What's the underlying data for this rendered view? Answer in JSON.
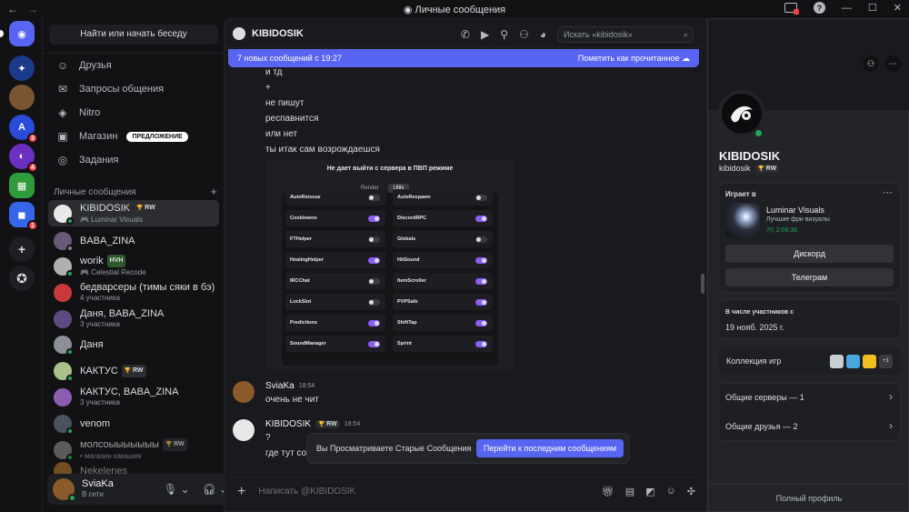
{
  "window": {
    "title": "Личные сообщения",
    "help_glyph": "?"
  },
  "servers": [
    {
      "name": "Discord Home",
      "glyph": "◉",
      "color": "#5865f2"
    },
    {
      "name": "server-2",
      "glyph": "✦",
      "color": "#1c3a8a"
    },
    {
      "name": "server-3",
      "glyph": "",
      "color": "#7a5533"
    },
    {
      "name": "server-4",
      "glyph": "A",
      "color": "#2a4bd8",
      "badge": "3"
    },
    {
      "name": "server-5",
      "glyph": "◐",
      "color": "#6b2fc2",
      "badge": "4"
    },
    {
      "name": "server-6",
      "glyph": "▦",
      "color": "#2f9b3a"
    },
    {
      "name": "server-7",
      "glyph": "◼",
      "color": "#3565e8",
      "badge": "1"
    }
  ],
  "sidebar": {
    "search_label": "Найти или начать беседу",
    "nav": [
      {
        "label": "Друзья",
        "icon": "friends-icon",
        "glyph": "☺"
      },
      {
        "label": "Запросы общения",
        "icon": "envelope-icon",
        "glyph": "✉"
      },
      {
        "label": "Nitro",
        "icon": "nitro-icon",
        "glyph": "◈"
      },
      {
        "label": "Магазин",
        "icon": "shop-icon",
        "glyph": "▣",
        "pill": "ПРЕДЛОЖЕНИЕ"
      },
      {
        "label": "Задания",
        "icon": "quests-icon",
        "glyph": "◎"
      }
    ],
    "dm_header": "Личные сообщения",
    "dms": [
      {
        "name": "KIBIDOSIK",
        "tag": "RW",
        "sub": "🎮 Luminar Visuals",
        "online": true
      },
      {
        "name": "BABA_ZINA",
        "tag": "",
        "sub": "",
        "online": false
      },
      {
        "name": "worik",
        "tag": "HVH",
        "sub": "🎮 Celestial Recode",
        "online": true
      },
      {
        "name": "бедварсеры (тимы сяки в бэ)",
        "tag": "",
        "sub": "4 участника",
        "online": false
      },
      {
        "name": "Даня, BABA_ZINA",
        "tag": "",
        "sub": "3 участника",
        "online": false
      },
      {
        "name": "Даня",
        "tag": "",
        "sub": "",
        "online": true
      },
      {
        "name": "КАКТУС",
        "tag": "RW",
        "sub": "",
        "online": true
      },
      {
        "name": "КАКТУС, BABA_ZINA",
        "tag": "",
        "sub": "3 участника",
        "online": false
      },
      {
        "name": "venom",
        "tag": "",
        "sub": "",
        "online": true
      },
      {
        "name": "молсоыыыыыыы",
        "tag": "RW",
        "sub": "• магазин какашек",
        "online": true
      },
      {
        "name": "Nekelenes",
        "tag": "",
        "sub": "",
        "online": true
      }
    ],
    "user": {
      "name": "SviaKa",
      "status": "В сети"
    }
  },
  "chat": {
    "header_name": "KIBIDOSIK",
    "search_placeholder": "Искать «kibidosik»",
    "new_messages": "7 новых сообщений с 19:27",
    "mark_read": "Пометить как прочитанное",
    "lines": [
      "и тд",
      "+",
      "не пишут",
      "респавнится",
      "или нет",
      "ты итак сам возрождаешся"
    ],
    "screenshot": {
      "title": "Не дает выйти с сервера в ПВП режиме",
      "tabs": [
        "Render",
        "Utils"
      ],
      "options_left": [
        {
          "label": "AutoReissue",
          "on": false
        },
        {
          "label": "Cooldowns",
          "on": true
        },
        {
          "label": "FTHelper",
          "on": false
        },
        {
          "label": "HealingHelper",
          "on": true
        },
        {
          "label": "IRCChat",
          "on": false
        },
        {
          "label": "LockSlot",
          "on": false
        },
        {
          "label": "Predictions",
          "on": true
        },
        {
          "label": "SoundManager",
          "on": true
        }
      ],
      "options_right": [
        {
          "label": "AutoRespawn",
          "on": false
        },
        {
          "label": "DiscordRPC",
          "on": true
        },
        {
          "label": "Globals",
          "on": false
        },
        {
          "label": "HitSound",
          "on": true
        },
        {
          "label": "ItemScroller",
          "on": true
        },
        {
          "label": "PVPSafe",
          "on": true
        },
        {
          "label": "ShiftTap",
          "on": true
        },
        {
          "label": "Sprint",
          "on": true
        }
      ]
    },
    "msg1": {
      "author": "SviaKa",
      "time": "18:54",
      "text": "очень не чит"
    },
    "msg2": {
      "author": "KIBIDOSIK",
      "tag": "RW",
      "time": "18:54",
      "lines": [
        "?",
        "где тут со"
      ]
    },
    "old_notice": "Вы Просматриваете Старые Сообщения",
    "jump_label": "Перейти к последним сообщениям",
    "composer_placeholder": "Написать @KIBIDOSIK"
  },
  "profile": {
    "display_name": "KIBIDOSIK",
    "username": "kibidosik",
    "tag": "RW",
    "playing_label": "Играет в",
    "game_title": "Luminar Visuals",
    "game_sub": "Лучшие фри визуалы",
    "game_time": "2:06:36",
    "btn1": "Дискорд",
    "btn2": "Телеграм",
    "member_since_label": "В числе участников с",
    "member_since": "19 нояб. 2025 г.",
    "collection_label": "Коллекция игр",
    "collection_more": "+1",
    "mutual_servers": "Общие серверы — 1",
    "mutual_friends": "Общие друзья — 2",
    "full_profile": "Полный профиль"
  }
}
